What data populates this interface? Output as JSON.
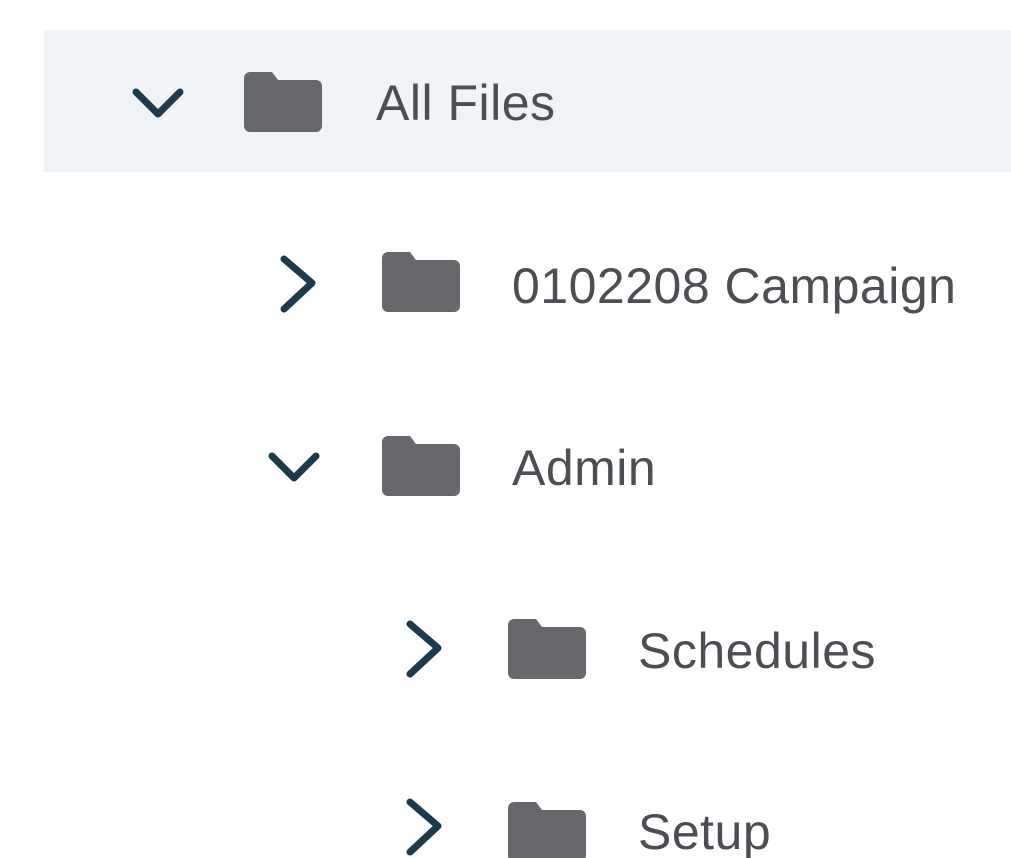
{
  "file_tree": {
    "root": {
      "label": "All Files",
      "expanded": true,
      "selected": true,
      "chevron_icon": "chevron-down-icon",
      "folder_icon": "folder-icon"
    },
    "items": [
      {
        "label": "0102208 Campaign",
        "expanded": false,
        "chevron_icon": "chevron-right-icon",
        "folder_icon": "folder-icon"
      },
      {
        "label": "Admin",
        "expanded": true,
        "chevron_icon": "chevron-down-icon",
        "folder_icon": "folder-icon",
        "children": [
          {
            "label": "Schedules",
            "expanded": false,
            "chevron_icon": "chevron-right-icon",
            "folder_icon": "folder-icon"
          },
          {
            "label": "Setup",
            "expanded": false,
            "chevron_icon": "chevron-right-icon",
            "folder_icon": "folder-icon"
          }
        ]
      }
    ]
  },
  "colors": {
    "chevron": "#1b3a4b",
    "folder": "#66686c",
    "label_text": "#4b4f54",
    "selected_row_bg": "#f1f4f6"
  }
}
